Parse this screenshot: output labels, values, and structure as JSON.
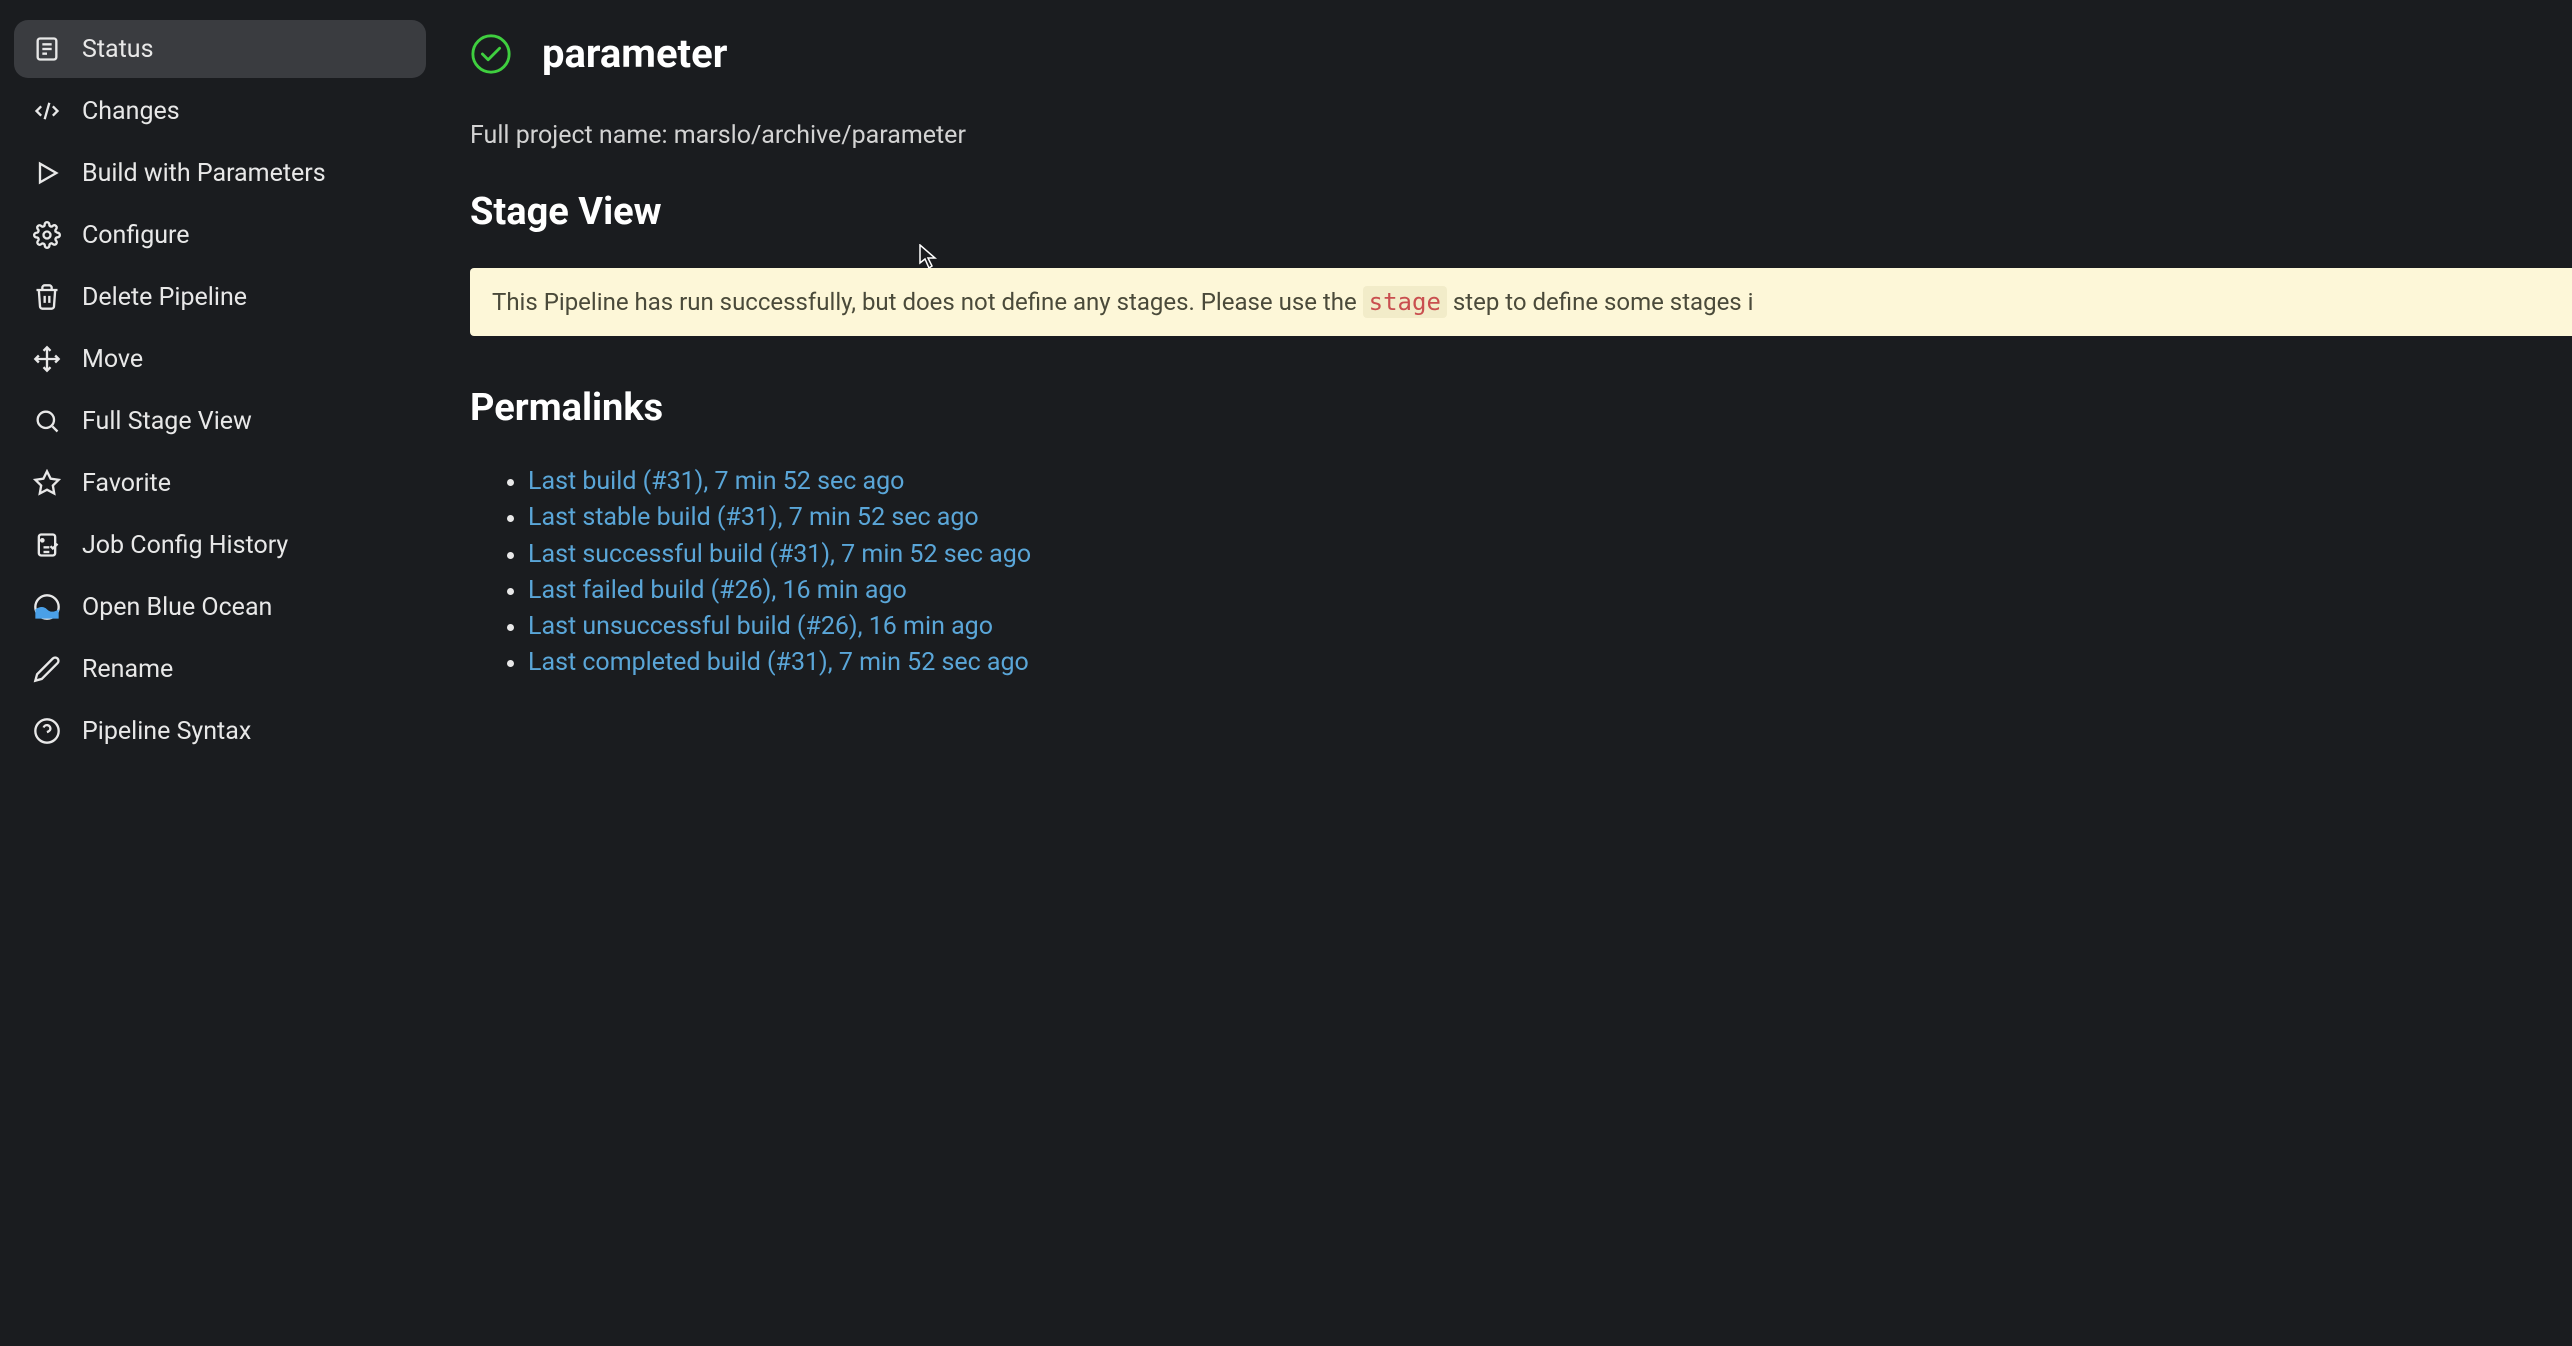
{
  "sidebar": {
    "items": [
      {
        "label": "Status"
      },
      {
        "label": "Changes"
      },
      {
        "label": "Build with Parameters"
      },
      {
        "label": "Configure"
      },
      {
        "label": "Delete Pipeline"
      },
      {
        "label": "Move"
      },
      {
        "label": "Full Stage View"
      },
      {
        "label": "Favorite"
      },
      {
        "label": "Job Config History"
      },
      {
        "label": "Open Blue Ocean"
      },
      {
        "label": "Rename"
      },
      {
        "label": "Pipeline Syntax"
      }
    ]
  },
  "page": {
    "title": "parameter",
    "fullname": "Full project name: marslo/archive/parameter"
  },
  "stageview": {
    "heading": "Stage View",
    "info_pre": "This Pipeline has run successfully, but does not define any stages. Please use the ",
    "info_code": "stage",
    "info_post": " step to define some stages i"
  },
  "permalinks": {
    "heading": "Permalinks",
    "items": [
      {
        "text": "Last build (#31), 7 min 52 sec ago"
      },
      {
        "text": "Last stable build (#31), 7 min 52 sec ago"
      },
      {
        "text": "Last successful build (#31), 7 min 52 sec ago"
      },
      {
        "text": "Last failed build (#26), 16 min ago"
      },
      {
        "text": "Last unsuccessful build (#26), 16 min ago"
      },
      {
        "text": "Last completed build (#31), 7 min 52 sec ago"
      }
    ]
  },
  "colors": {
    "success": "#3fcf3f",
    "link": "#5aa6d8"
  }
}
